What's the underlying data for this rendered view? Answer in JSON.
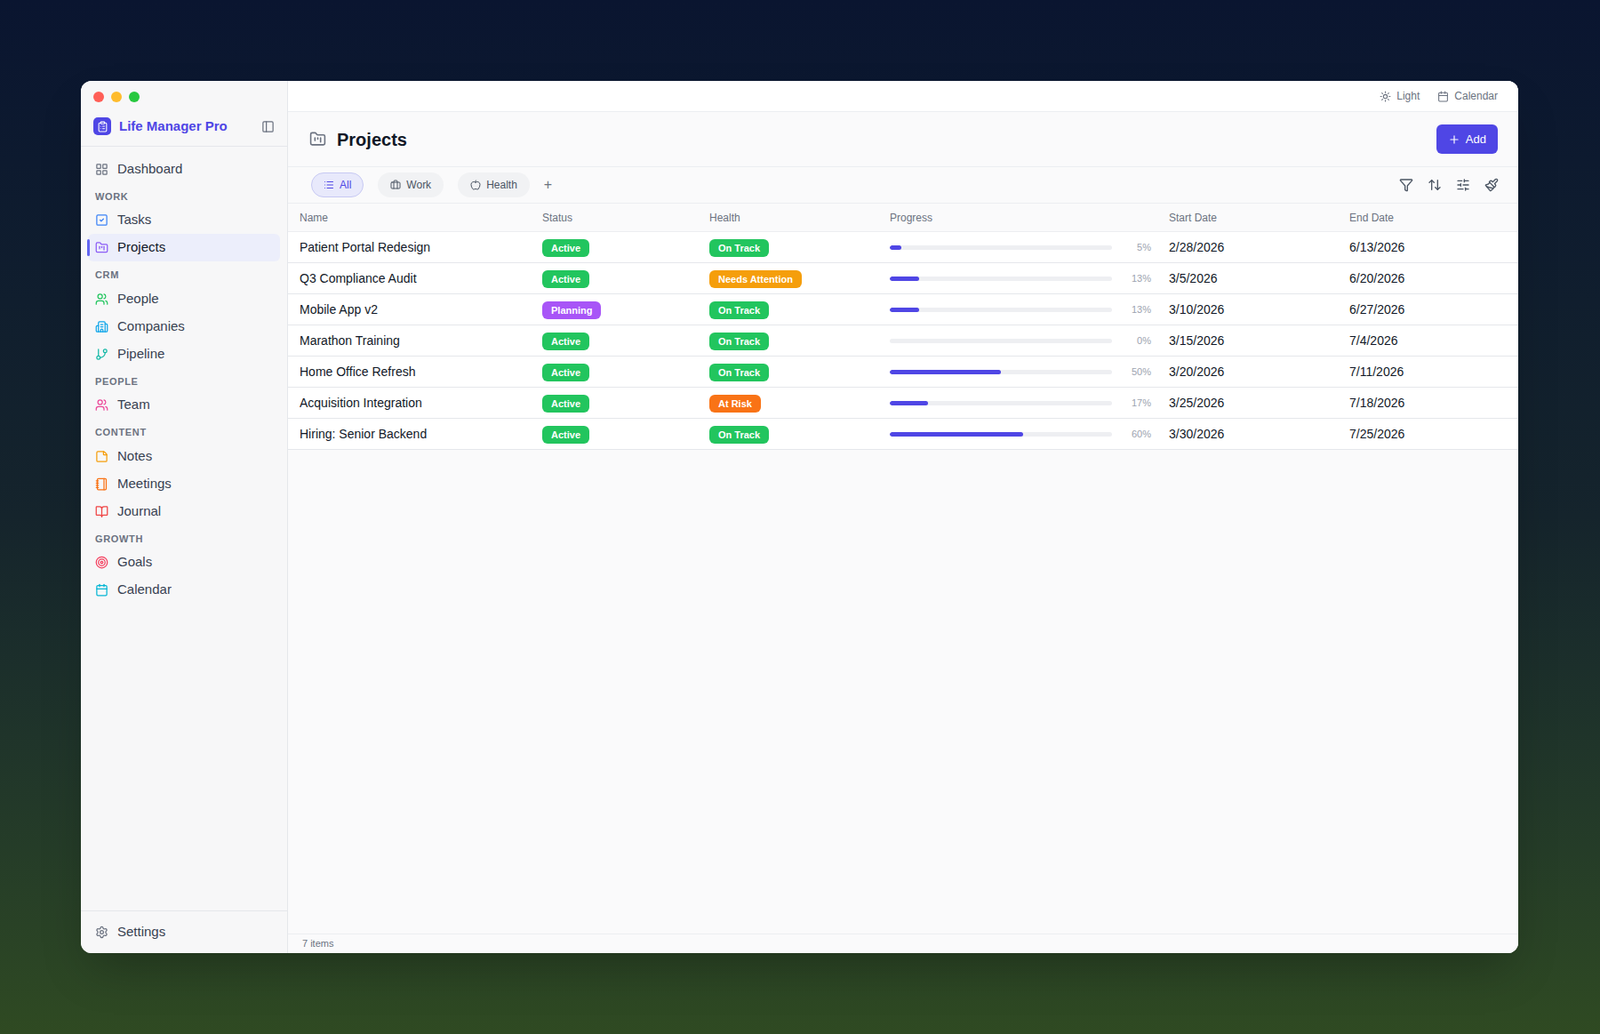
{
  "window": {
    "app_name": "Life Manager Pro"
  },
  "topbar": {
    "buttons": [
      "Light",
      "Calendar"
    ]
  },
  "sidebar": {
    "items": [
      {
        "kind": "item",
        "label": "Dashboard",
        "selected": false,
        "color": "#6b7280"
      },
      {
        "kind": "section",
        "label": "WORK"
      },
      {
        "kind": "item",
        "label": "Tasks",
        "selected": false,
        "color": "#3b82f6"
      },
      {
        "kind": "item",
        "label": "Projects",
        "selected": true,
        "color": "#8b5cf6"
      },
      {
        "kind": "section",
        "label": "CRM"
      },
      {
        "kind": "item",
        "label": "People",
        "selected": false,
        "color": "#22c55e"
      },
      {
        "kind": "item",
        "label": "Companies",
        "selected": false,
        "color": "#0ea5e9"
      },
      {
        "kind": "item",
        "label": "Pipeline",
        "selected": false,
        "color": "#14b8a6"
      },
      {
        "kind": "section",
        "label": "PEOPLE"
      },
      {
        "kind": "item",
        "label": "Team",
        "selected": false,
        "color": "#ec4899"
      },
      {
        "kind": "section",
        "label": "CONTENT"
      },
      {
        "kind": "item",
        "label": "Notes",
        "selected": false,
        "color": "#f59e0b"
      },
      {
        "kind": "item",
        "label": "Meetings",
        "selected": false,
        "color": "#f97316"
      },
      {
        "kind": "item",
        "label": "Journal",
        "selected": false,
        "color": "#ef4444"
      },
      {
        "kind": "section",
        "label": "GROWTH"
      },
      {
        "kind": "item",
        "label": "Goals",
        "selected": false,
        "color": "#f43f5e"
      },
      {
        "kind": "item",
        "label": "Calendar",
        "selected": false,
        "color": "#06b6d4"
      }
    ],
    "settings": "Settings"
  },
  "page": {
    "title": "Projects",
    "add_button": "Add"
  },
  "views": [
    {
      "label": "All",
      "selected": true
    },
    {
      "label": "Work",
      "selected": false
    },
    {
      "label": "Health",
      "selected": false
    }
  ],
  "add_view": "+",
  "table": {
    "columns": [
      "Name",
      "Status",
      "Health",
      "Progress",
      "Start Date",
      "End Date"
    ],
    "rows": [
      {
        "name": "Patient Portal Redesign",
        "status": {
          "label": "Active",
          "color": "#22c55e"
        },
        "health": {
          "label": "On Track",
          "color": "#22c55e"
        },
        "level": 0.05,
        "progress": "5%",
        "start": "2/28/2026",
        "end": "6/13/2026"
      },
      {
        "name": "Q3 Compliance Audit",
        "status": {
          "label": "Active",
          "color": "#22c55e"
        },
        "health": {
          "label": "Needs Attention",
          "color": "#f59e0b"
        },
        "level": 0.13,
        "progress": "13%",
        "start": "3/5/2026",
        "end": "6/20/2026"
      },
      {
        "name": "Mobile App v2",
        "status": {
          "label": "Planning",
          "color": "#a855f7"
        },
        "health": {
          "label": "On Track",
          "color": "#22c55e"
        },
        "level": 0.13,
        "progress": "13%",
        "start": "3/10/2026",
        "end": "6/27/2026"
      },
      {
        "name": "Marathon Training",
        "status": {
          "label": "Active",
          "color": "#22c55e"
        },
        "health": {
          "label": "On Track",
          "color": "#22c55e"
        },
        "level": 0,
        "progress": "0%",
        "start": "3/15/2026",
        "end": "7/4/2026"
      },
      {
        "name": "Home Office Refresh",
        "status": {
          "label": "Active",
          "color": "#22c55e"
        },
        "health": {
          "label": "On Track",
          "color": "#22c55e"
        },
        "level": 0.5,
        "progress": "50%",
        "start": "3/20/2026",
        "end": "7/11/2026"
      },
      {
        "name": "Acquisition Integration",
        "status": {
          "label": "Active",
          "color": "#22c55e"
        },
        "health": {
          "label": "At Risk",
          "color": "#f97316"
        },
        "level": 0.17,
        "progress": "17%",
        "start": "3/25/2026",
        "end": "7/18/2026"
      },
      {
        "name": "Hiring: Senior Backend",
        "status": {
          "label": "Active",
          "color": "#22c55e"
        },
        "health": {
          "label": "On Track",
          "color": "#22c55e"
        },
        "level": 0.6,
        "progress": "60%",
        "start": "3/30/2026",
        "end": "7/25/2026"
      }
    ]
  },
  "status_bar": "7 items"
}
